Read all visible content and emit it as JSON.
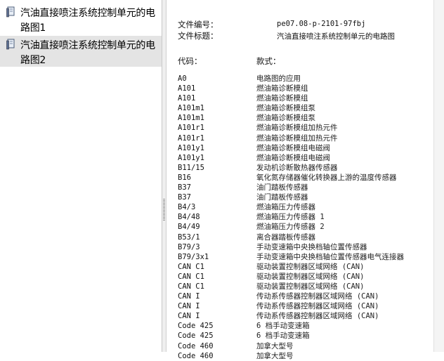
{
  "sidebar": {
    "items": [
      {
        "label": "汽油直接喷注系统控制单元的电路图1",
        "selected": false
      },
      {
        "label": "汽油直接喷注系统控制单元的电路图2",
        "selected": true
      }
    ]
  },
  "document": {
    "file_number_label": "文件编号：",
    "file_number": "pe07.08-p-2101-97fbj",
    "file_title_label": "文件标题：",
    "file_title": "汽油直接喷注系统控制单元的电路图",
    "code_header": "代码：",
    "model_header": "款式：",
    "rows": [
      {
        "code": "A0",
        "desc": "电路图的应用"
      },
      {
        "code": "A101",
        "desc": "燃油箱诊断模组"
      },
      {
        "code": "A101",
        "desc": "燃油箱诊断模组"
      },
      {
        "code": "A101m1",
        "desc": "燃油箱诊断模组泵"
      },
      {
        "code": "A101m1",
        "desc": "燃油箱诊断模组泵"
      },
      {
        "code": "A101r1",
        "desc": "燃油箱诊断模组加热元件"
      },
      {
        "code": "A101r1",
        "desc": "燃油箱诊断模组加热元件"
      },
      {
        "code": "A101y1",
        "desc": "燃油箱诊断模组电磁阀"
      },
      {
        "code": "A101y1",
        "desc": "燃油箱诊断模组电磁阀"
      },
      {
        "code": "B11/15",
        "desc": "发动机诊断散热器传感器"
      },
      {
        "code": "B16",
        "desc": "氧化氮存储器催化转换器上游的温度传感器"
      },
      {
        "code": "B37",
        "desc": "油门踏板传感器"
      },
      {
        "code": "B37",
        "desc": "油门踏板传感器"
      },
      {
        "code": "B4/3",
        "desc": "燃油箱压力传感器"
      },
      {
        "code": "B4/48",
        "desc": "燃油箱压力传感器 1"
      },
      {
        "code": "B4/49",
        "desc": "燃油箱压力传感器 2"
      },
      {
        "code": "B53/1",
        "desc": "离合器踏板传感器"
      },
      {
        "code": "B79/3",
        "desc": "手动变速箱中央换档轴位置传感器"
      },
      {
        "code": "B79/3x1",
        "desc": "手动变速箱中央换档轴位置传感器电气连接器"
      },
      {
        "code": "CAN C1",
        "desc": "驱动装置控制器区域网络 (CAN)"
      },
      {
        "code": "CAN C1",
        "desc": "驱动装置控制器区域网络 (CAN)"
      },
      {
        "code": "CAN C1",
        "desc": "驱动装置控制器区域网络 (CAN)"
      },
      {
        "code": "CAN I",
        "desc": "传动系传感器控制器区域网络 (CAN)"
      },
      {
        "code": "CAN I",
        "desc": "传动系传感器控制器区域网络 (CAN)"
      },
      {
        "code": "CAN I",
        "desc": "传动系传感器控制器区域网络 (CAN)"
      },
      {
        "code": "Code 425",
        "desc": "6 档手动变速箱"
      },
      {
        "code": "Code 425",
        "desc": "6 档手动变速箱"
      },
      {
        "code": "Code 460",
        "desc": "加拿大型号"
      },
      {
        "code": "Code 460",
        "desc": "加拿大型号"
      }
    ]
  },
  "colors": {
    "selected_bg": "#e4e4e4",
    "icon": "file-tab-icon"
  }
}
